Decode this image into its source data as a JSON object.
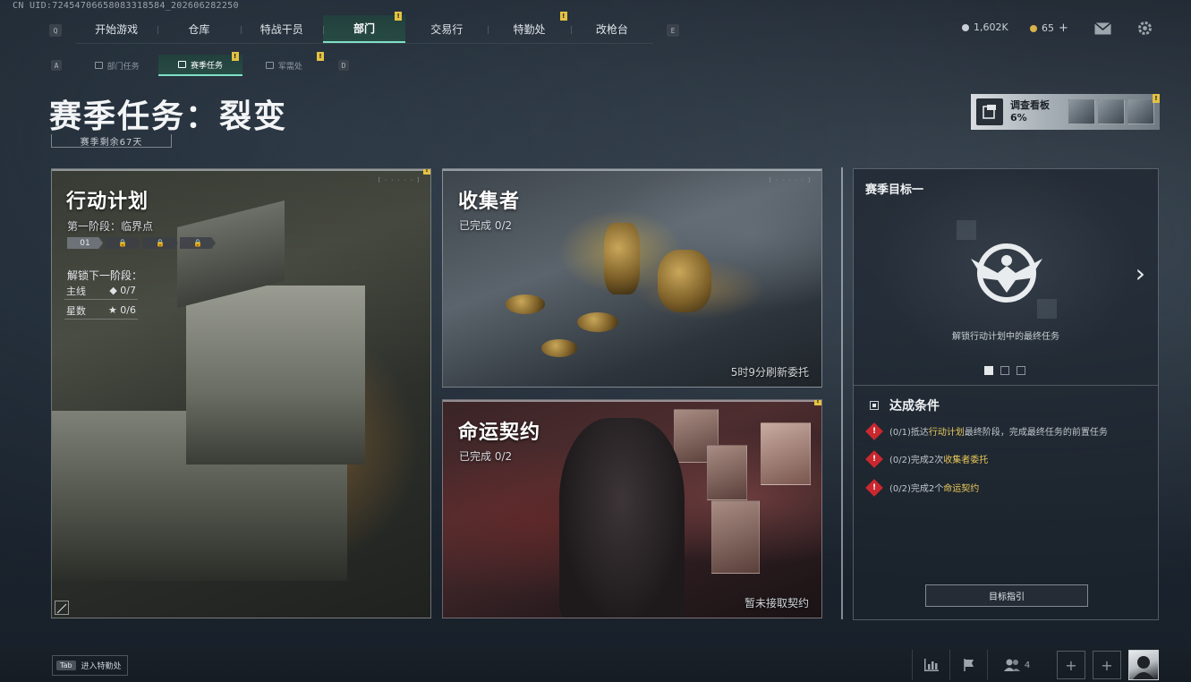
{
  "uid_line": "CN UID:7245470665808331858­4_202606282250",
  "top_nav": {
    "left_key": "Q",
    "right_key": "E",
    "tabs": [
      {
        "label": "开始游戏",
        "active": false,
        "badge": ""
      },
      {
        "label": "仓库",
        "active": false,
        "badge": ""
      },
      {
        "label": "特战干员",
        "active": false,
        "badge": ""
      },
      {
        "label": "部门",
        "active": true,
        "badge": "!"
      },
      {
        "label": "交易行",
        "active": false,
        "badge": ""
      },
      {
        "label": "特勤处",
        "active": false,
        "badge": "!"
      },
      {
        "label": "改枪台",
        "active": false,
        "badge": ""
      }
    ]
  },
  "sub_nav": {
    "left_key": "A",
    "right_key": "D",
    "tabs": [
      {
        "label": "部门任务",
        "active": false,
        "badge": ""
      },
      {
        "label": "赛季任务",
        "active": true,
        "badge": "!"
      },
      {
        "label": "军需处",
        "active": false,
        "badge": "!"
      }
    ]
  },
  "currency": {
    "silver": "1,602K",
    "gold": "65",
    "add": "+"
  },
  "page": {
    "title": "赛季任务：裂变",
    "season_remaining": "赛季剩余67天"
  },
  "investigation_board": {
    "label": "调查看板",
    "percent": "6%",
    "badge": "!"
  },
  "cards": {
    "action_plan": {
      "title": "行动计划",
      "stage": "第一阶段：临界点",
      "current_stage": "01",
      "unlock_label": "解锁下一阶段：",
      "main_line_label": "主线",
      "main_line_value": "◆ 0/7",
      "stars_label": "星数",
      "stars_value": "★ 0/6",
      "badge": "!"
    },
    "collector": {
      "title": "收集者",
      "progress": "已完成 0/2",
      "footer": "5时9分刷新委托"
    },
    "fate_contract": {
      "title": "命运契约",
      "progress": "已完成 0/2",
      "footer": "暂未接取契约",
      "badge": "!"
    }
  },
  "season_goal": {
    "title": "赛季目标一",
    "description": "解锁行动计划中的最终任务",
    "conditions_title": "达成条件",
    "conditions": [
      {
        "prefix": "(0/1)抵达",
        "highlight": "行动计划",
        "suffix": "最终阶段，完成最终任务的前置任务"
      },
      {
        "prefix": "(0/2)完成2次",
        "highlight": "收集者委托",
        "suffix": ""
      },
      {
        "prefix": "(0/2)完成2个",
        "highlight": "命运契约",
        "suffix": ""
      }
    ],
    "guide_button": "目标指引"
  },
  "bottom_bar": {
    "tab_key": "Tab",
    "tab_label": "进入特勤处",
    "squad_count": "4",
    "slot_plus": "+"
  },
  "colors": {
    "accent": "#7fe0c8",
    "badge": "#e3c244",
    "highlight": "#e8c85a",
    "warning": "#c8282e"
  }
}
